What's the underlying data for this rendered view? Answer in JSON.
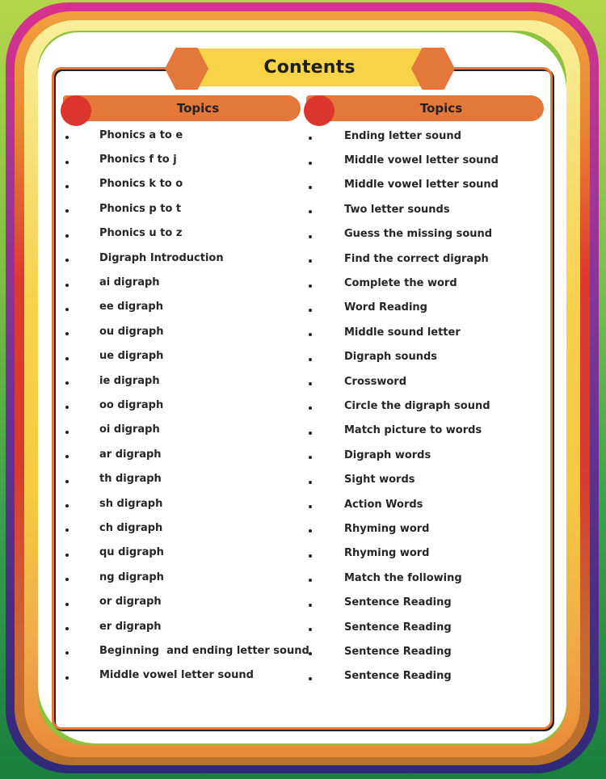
{
  "title": "Contents",
  "colors": {
    "accent_orange": "#e4773a",
    "title_yellow": "#f8d347",
    "dot_red": "#dc3530"
  },
  "columns": [
    {
      "header": "Topics",
      "items": [
        "Phonics a to e",
        "Phonics f to j",
        "Phonics k to o",
        "Phonics p to t",
        "Phonics u to z",
        "Digraph Introduction",
        "ai digraph",
        "ee digraph",
        "ou digraph",
        "ue digraph",
        "ie digraph",
        "oo digraph",
        "oi digraph",
        "ar digraph",
        "th digraph",
        "sh digraph",
        "ch digraph",
        "qu digraph",
        "ng digraph",
        "or digraph",
        "er digraph",
        "Beginning  and ending letter sound",
        "Middle vowel letter sound"
      ]
    },
    {
      "header": "Topics",
      "items": [
        "Ending letter sound",
        "Middle vowel letter sound",
        "Middle vowel letter sound",
        "Two letter sounds",
        "Guess the missing sound",
        "Find the correct digraph",
        "Complete the word",
        "Word Reading",
        "Middle sound letter",
        "Digraph sounds",
        "Crossword",
        "Circle the digraph sound",
        "Match picture to words",
        "Digraph words",
        "Sight words",
        "Action Words",
        "Rhyming word",
        "Rhyming word",
        "Match the following",
        "Sentence Reading",
        "Sentence Reading",
        "Sentence Reading",
        "Sentence Reading"
      ]
    }
  ]
}
